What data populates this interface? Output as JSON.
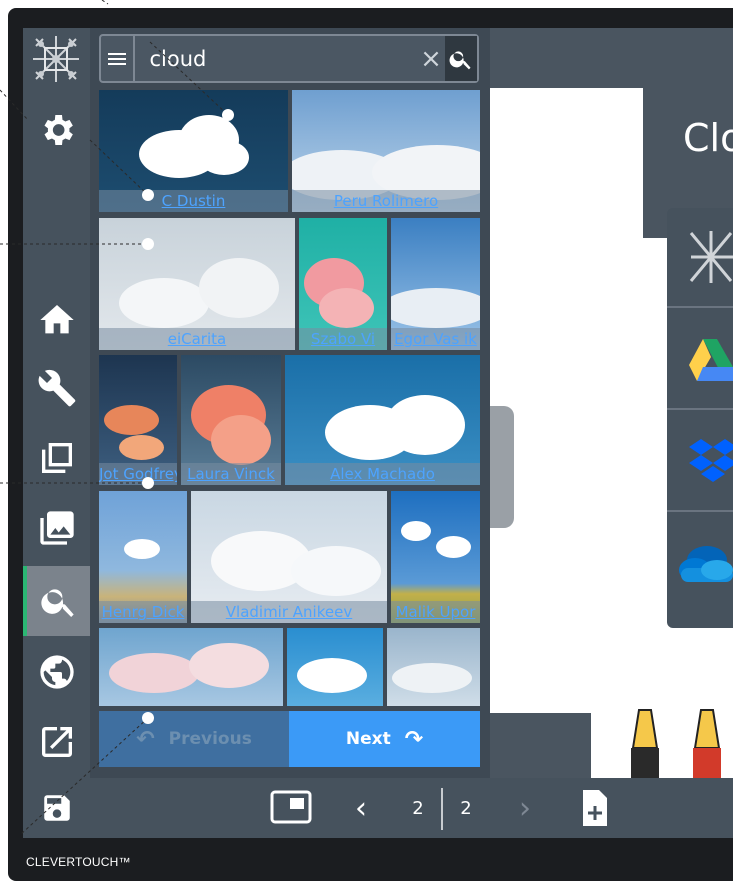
{
  "search": {
    "value": "cloud",
    "clear_glyph": "×"
  },
  "results": [
    {
      "credit": "C Dustin"
    },
    {
      "credit": "Peru Rolimero"
    },
    {
      "credit": "eiCarita"
    },
    {
      "credit": "Szabo Vi"
    },
    {
      "credit": "Egor Vas ik"
    },
    {
      "credit": "Jot Godfrey"
    },
    {
      "credit": "Laura Vinck"
    },
    {
      "credit": "Alex Machado"
    },
    {
      "credit": "Henrg Dick"
    },
    {
      "credit": "Vladimir Anikeev"
    },
    {
      "credit": "Malik Upor"
    },
    {
      "credit": ""
    },
    {
      "credit": ""
    },
    {
      "credit": ""
    }
  ],
  "pager": {
    "previous_label": "Previous",
    "next_label": "Next"
  },
  "bottom": {
    "current_page": "2",
    "total_pages": "2"
  },
  "canvas": {
    "title_fragment": "Clo"
  },
  "brand": "CLEVERTOUCH™",
  "colors": {
    "accent_green": "#2bb673",
    "next_blue": "#3b9af7",
    "credit_link": "#4da3ff"
  }
}
